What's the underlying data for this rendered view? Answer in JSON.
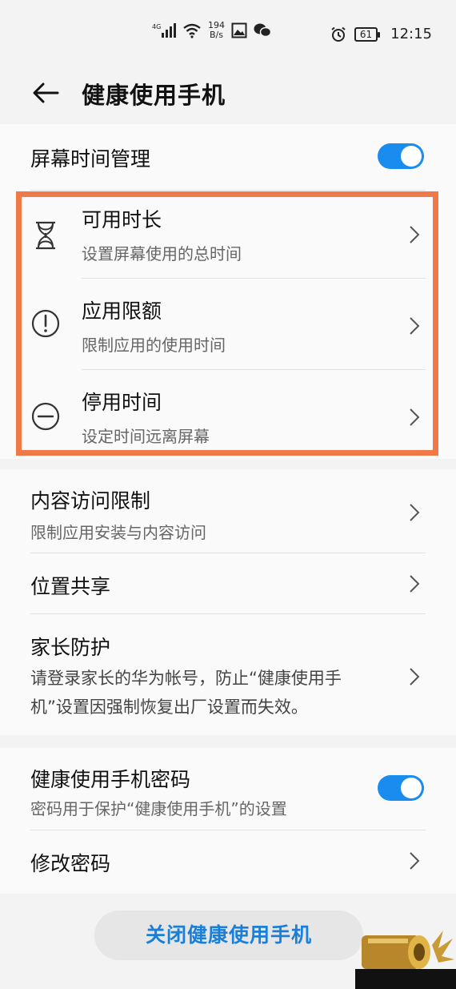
{
  "status_bar": {
    "network": "4G",
    "speed_value": "194",
    "speed_unit": "B/s",
    "battery": "61",
    "time": "12:15"
  },
  "header": {
    "title": "健康使用手机"
  },
  "screen_time": {
    "label": "屏幕时间管理",
    "enabled": true
  },
  "limits": [
    {
      "title": "可用时长",
      "subtitle": "设置屏幕使用的总时间",
      "icon": "hourglass-icon"
    },
    {
      "title": "应用限额",
      "subtitle": "限制应用的使用时间",
      "icon": "exclamation-circle-icon"
    },
    {
      "title": "停用时间",
      "subtitle": "设定时间远离屏幕",
      "icon": "minus-circle-icon"
    }
  ],
  "content_restriction": {
    "title": "内容访问限制",
    "subtitle": "限制应用安装与内容访问"
  },
  "location_share": {
    "title": "位置共享"
  },
  "parental": {
    "title": "家长防护",
    "subtitle_line1": "请登录家长的华为帐号，防止“健康使用手",
    "subtitle_line2": "机”设置因强制恢复出厂设置而失效。"
  },
  "password": {
    "title": "健康使用手机密码",
    "subtitle": "密码用于保护“健康使用手机”的设置",
    "enabled": true
  },
  "change_password": {
    "title": "修改密码"
  },
  "close_button": {
    "label": "关闭健康使用手机"
  },
  "colors": {
    "accent": "#1a8cf0",
    "highlight": "#f07a47",
    "link": "#1a7fd8"
  }
}
